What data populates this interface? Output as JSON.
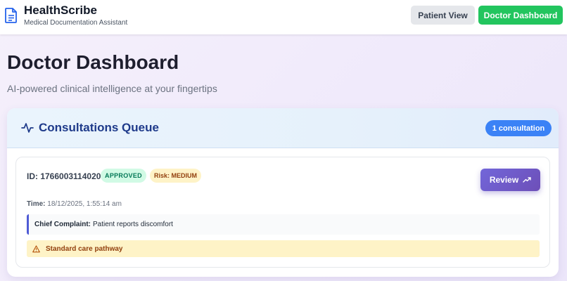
{
  "header": {
    "app_name": "HealthScribe",
    "tagline": "Medical Documentation Assistant",
    "nav": {
      "patient_view_label": "Patient View",
      "doctor_dashboard_label": "Doctor Dashboard"
    }
  },
  "page": {
    "title": "Doctor Dashboard",
    "subtitle": "AI-powered clinical intelligence at your fingertips"
  },
  "queue": {
    "title": "Consultations Queue",
    "count_label": "1 consultation",
    "items": [
      {
        "id_label": "ID: 1766003114020",
        "status": "APPROVED",
        "risk": "Risk: MEDIUM",
        "review_label": "Review",
        "time_label": "Time:",
        "time_value": "18/12/2025, 1:55:14 am",
        "complaint_label": "Chief Complaint:",
        "complaint_value": "Patient reports discomfort",
        "pathway": "Standard care pathway"
      }
    ]
  },
  "icons": {
    "brand": "document-icon",
    "queue": "activity-pulse-icon",
    "review": "trending-up-icon",
    "pathway": "warning-triangle-icon"
  },
  "colors": {
    "primary_green": "#22c55e",
    "badge_blue": "#3b82f6",
    "review_purple": "#6d4fb8",
    "approved_bg": "#d1fae5",
    "risk_bg": "#fef3c7",
    "title_navy": "#1e3a8a"
  }
}
